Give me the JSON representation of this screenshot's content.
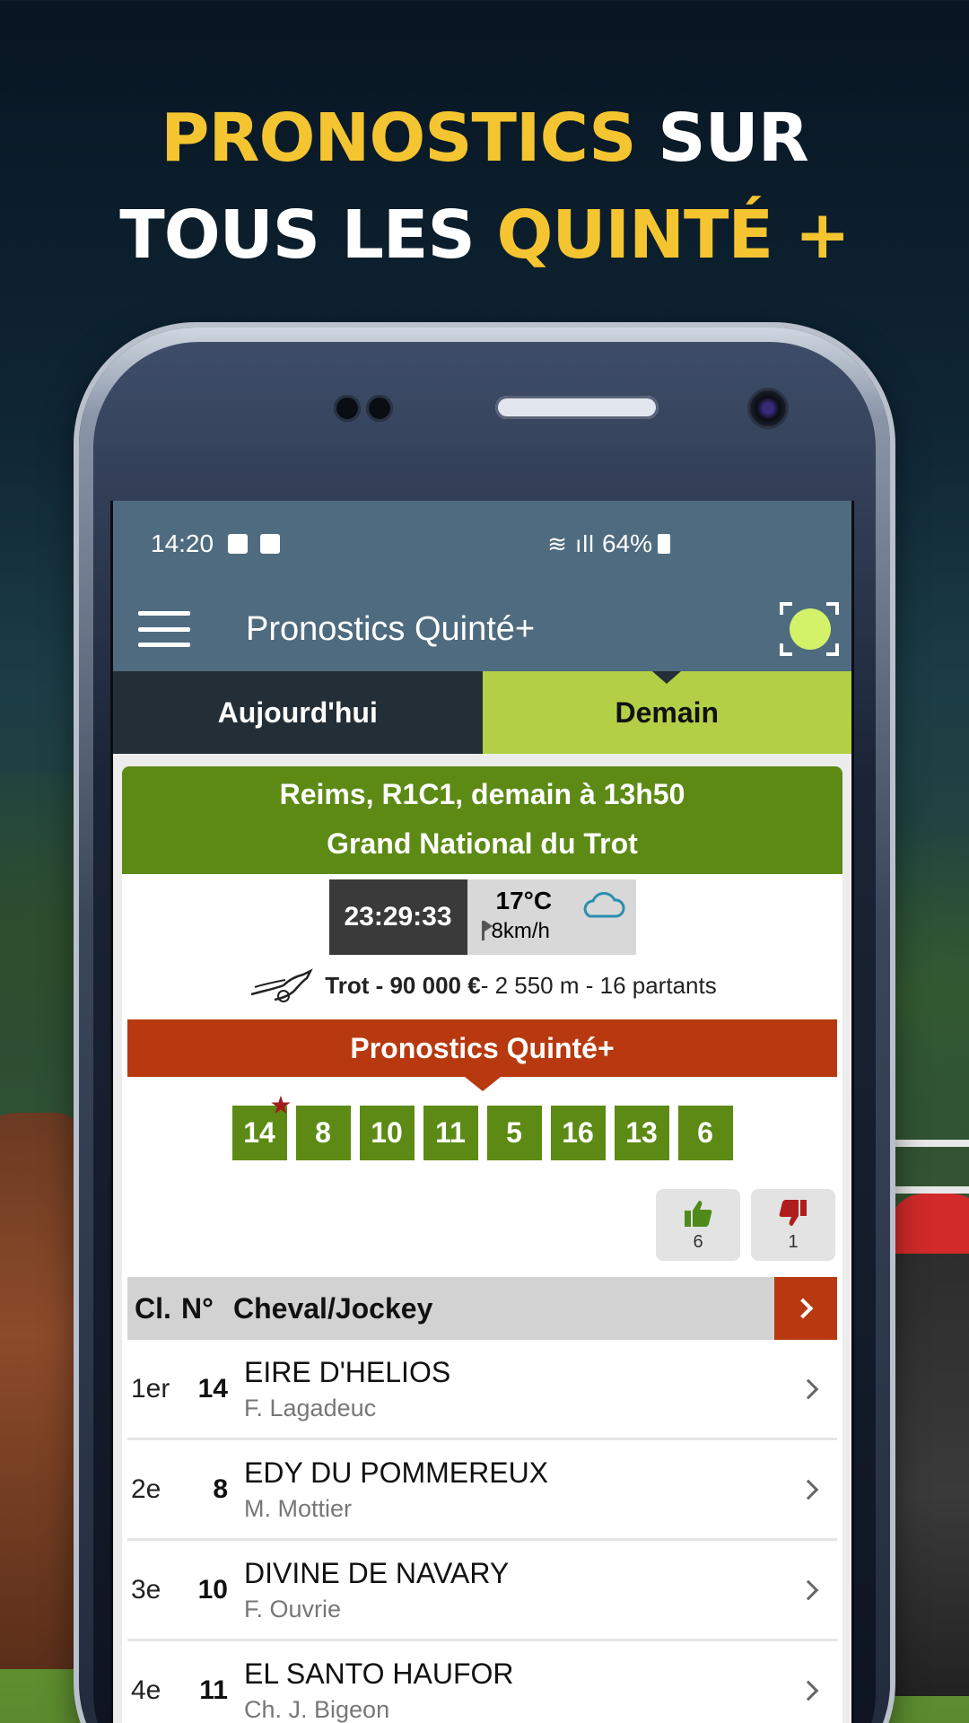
{
  "headline": {
    "line1_accent": "PRONOSTICS",
    "line1_rest": " SUR",
    "line2_start": "TOUS LES ",
    "line2_accent": "QUINTÉ +"
  },
  "colors": {
    "accent_yellow": "#f4c531",
    "app_bar": "#4f6b7f",
    "race_green": "#5c8a14",
    "tab_active": "#b3cf46",
    "banner_red": "#b8390f"
  },
  "status_bar": {
    "time": "14:20",
    "battery": "64%"
  },
  "app_bar": {
    "title": "Pronostics Quinté+"
  },
  "tabs": [
    {
      "label": "Aujourd'hui"
    },
    {
      "label": "Demain"
    }
  ],
  "race": {
    "line1": "Reims, R1C1, demain à 13h50",
    "line2": "Grand National du Trot",
    "countdown": "23:29:33",
    "temperature": "17°C",
    "wind": "8km/h",
    "meta_bold": "Trot - 90 000 €",
    "meta_rest": " - 2 550 m - 16 partants"
  },
  "pronostics": {
    "banner": "Pronostics Quinté+",
    "picks": [
      "14",
      "8",
      "10",
      "11",
      "5",
      "16",
      "13",
      "6"
    ]
  },
  "votes": {
    "up": "6",
    "down": "1"
  },
  "list": {
    "header_rank": "Cl.",
    "header_num": "N°",
    "header_name": "Cheval/Jockey",
    "rows": [
      {
        "rank": "1er",
        "num": "14",
        "horse": "EIRE D'HELIOS",
        "jockey": "F. Lagadeuc"
      },
      {
        "rank": "2e",
        "num": "8",
        "horse": "EDY DU POMMEREUX",
        "jockey": "M. Mottier"
      },
      {
        "rank": "3e",
        "num": "10",
        "horse": "DIVINE DE NAVARY",
        "jockey": "F. Ouvrie"
      },
      {
        "rank": "4e",
        "num": "11",
        "horse": "EL SANTO HAUFOR",
        "jockey": "Ch. J. Bigeon"
      }
    ]
  }
}
